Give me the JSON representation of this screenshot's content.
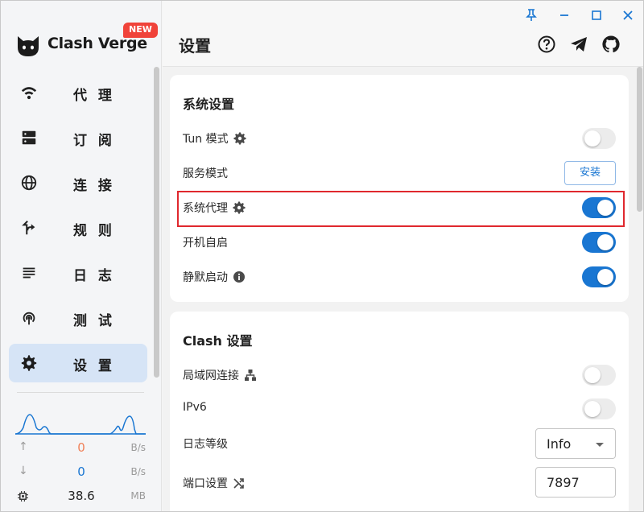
{
  "app": {
    "name": "Clash Verge",
    "badge": "NEW"
  },
  "sidebar": {
    "items": [
      {
        "label": "代 理",
        "icon": "wifi-icon"
      },
      {
        "label": "订 阅",
        "icon": "server-icon"
      },
      {
        "label": "连 接",
        "icon": "globe-icon"
      },
      {
        "label": "规 则",
        "icon": "fork-arrow-icon"
      },
      {
        "label": "日 志",
        "icon": "list-lines-icon"
      },
      {
        "label": "测 试",
        "icon": "signal-icon"
      },
      {
        "label": "设 置",
        "icon": "gear-icon",
        "active": true
      }
    ],
    "traffic": {
      "upload_value": "0",
      "upload_unit": "B/s",
      "download_value": "0",
      "download_unit": "B/s",
      "memory_value": "38.6",
      "memory_unit": "MB",
      "upload_color": "#f0825a",
      "download_color": "#1976d2"
    }
  },
  "header": {
    "title": "设置"
  },
  "system_settings": {
    "title": "系统设置",
    "tun_mode": {
      "label": "Tun 模式",
      "enabled": false
    },
    "service_mode": {
      "label": "服务模式",
      "button": "安装"
    },
    "system_proxy": {
      "label": "系统代理",
      "enabled": true
    },
    "auto_launch": {
      "label": "开机自启",
      "enabled": true
    },
    "silent_start": {
      "label": "静默启动",
      "enabled": true
    }
  },
  "clash_settings": {
    "title": "Clash 设置",
    "allow_lan": {
      "label": "局域网连接",
      "enabled": false
    },
    "ipv6": {
      "label": "IPv6",
      "enabled": false
    },
    "log_level": {
      "label": "日志等级",
      "value": "Info"
    },
    "port": {
      "label": "端口设置",
      "value": "7897"
    }
  },
  "colors": {
    "accent": "#1976d2",
    "highlight_border": "#e0282e",
    "badge": "#f0433a"
  }
}
